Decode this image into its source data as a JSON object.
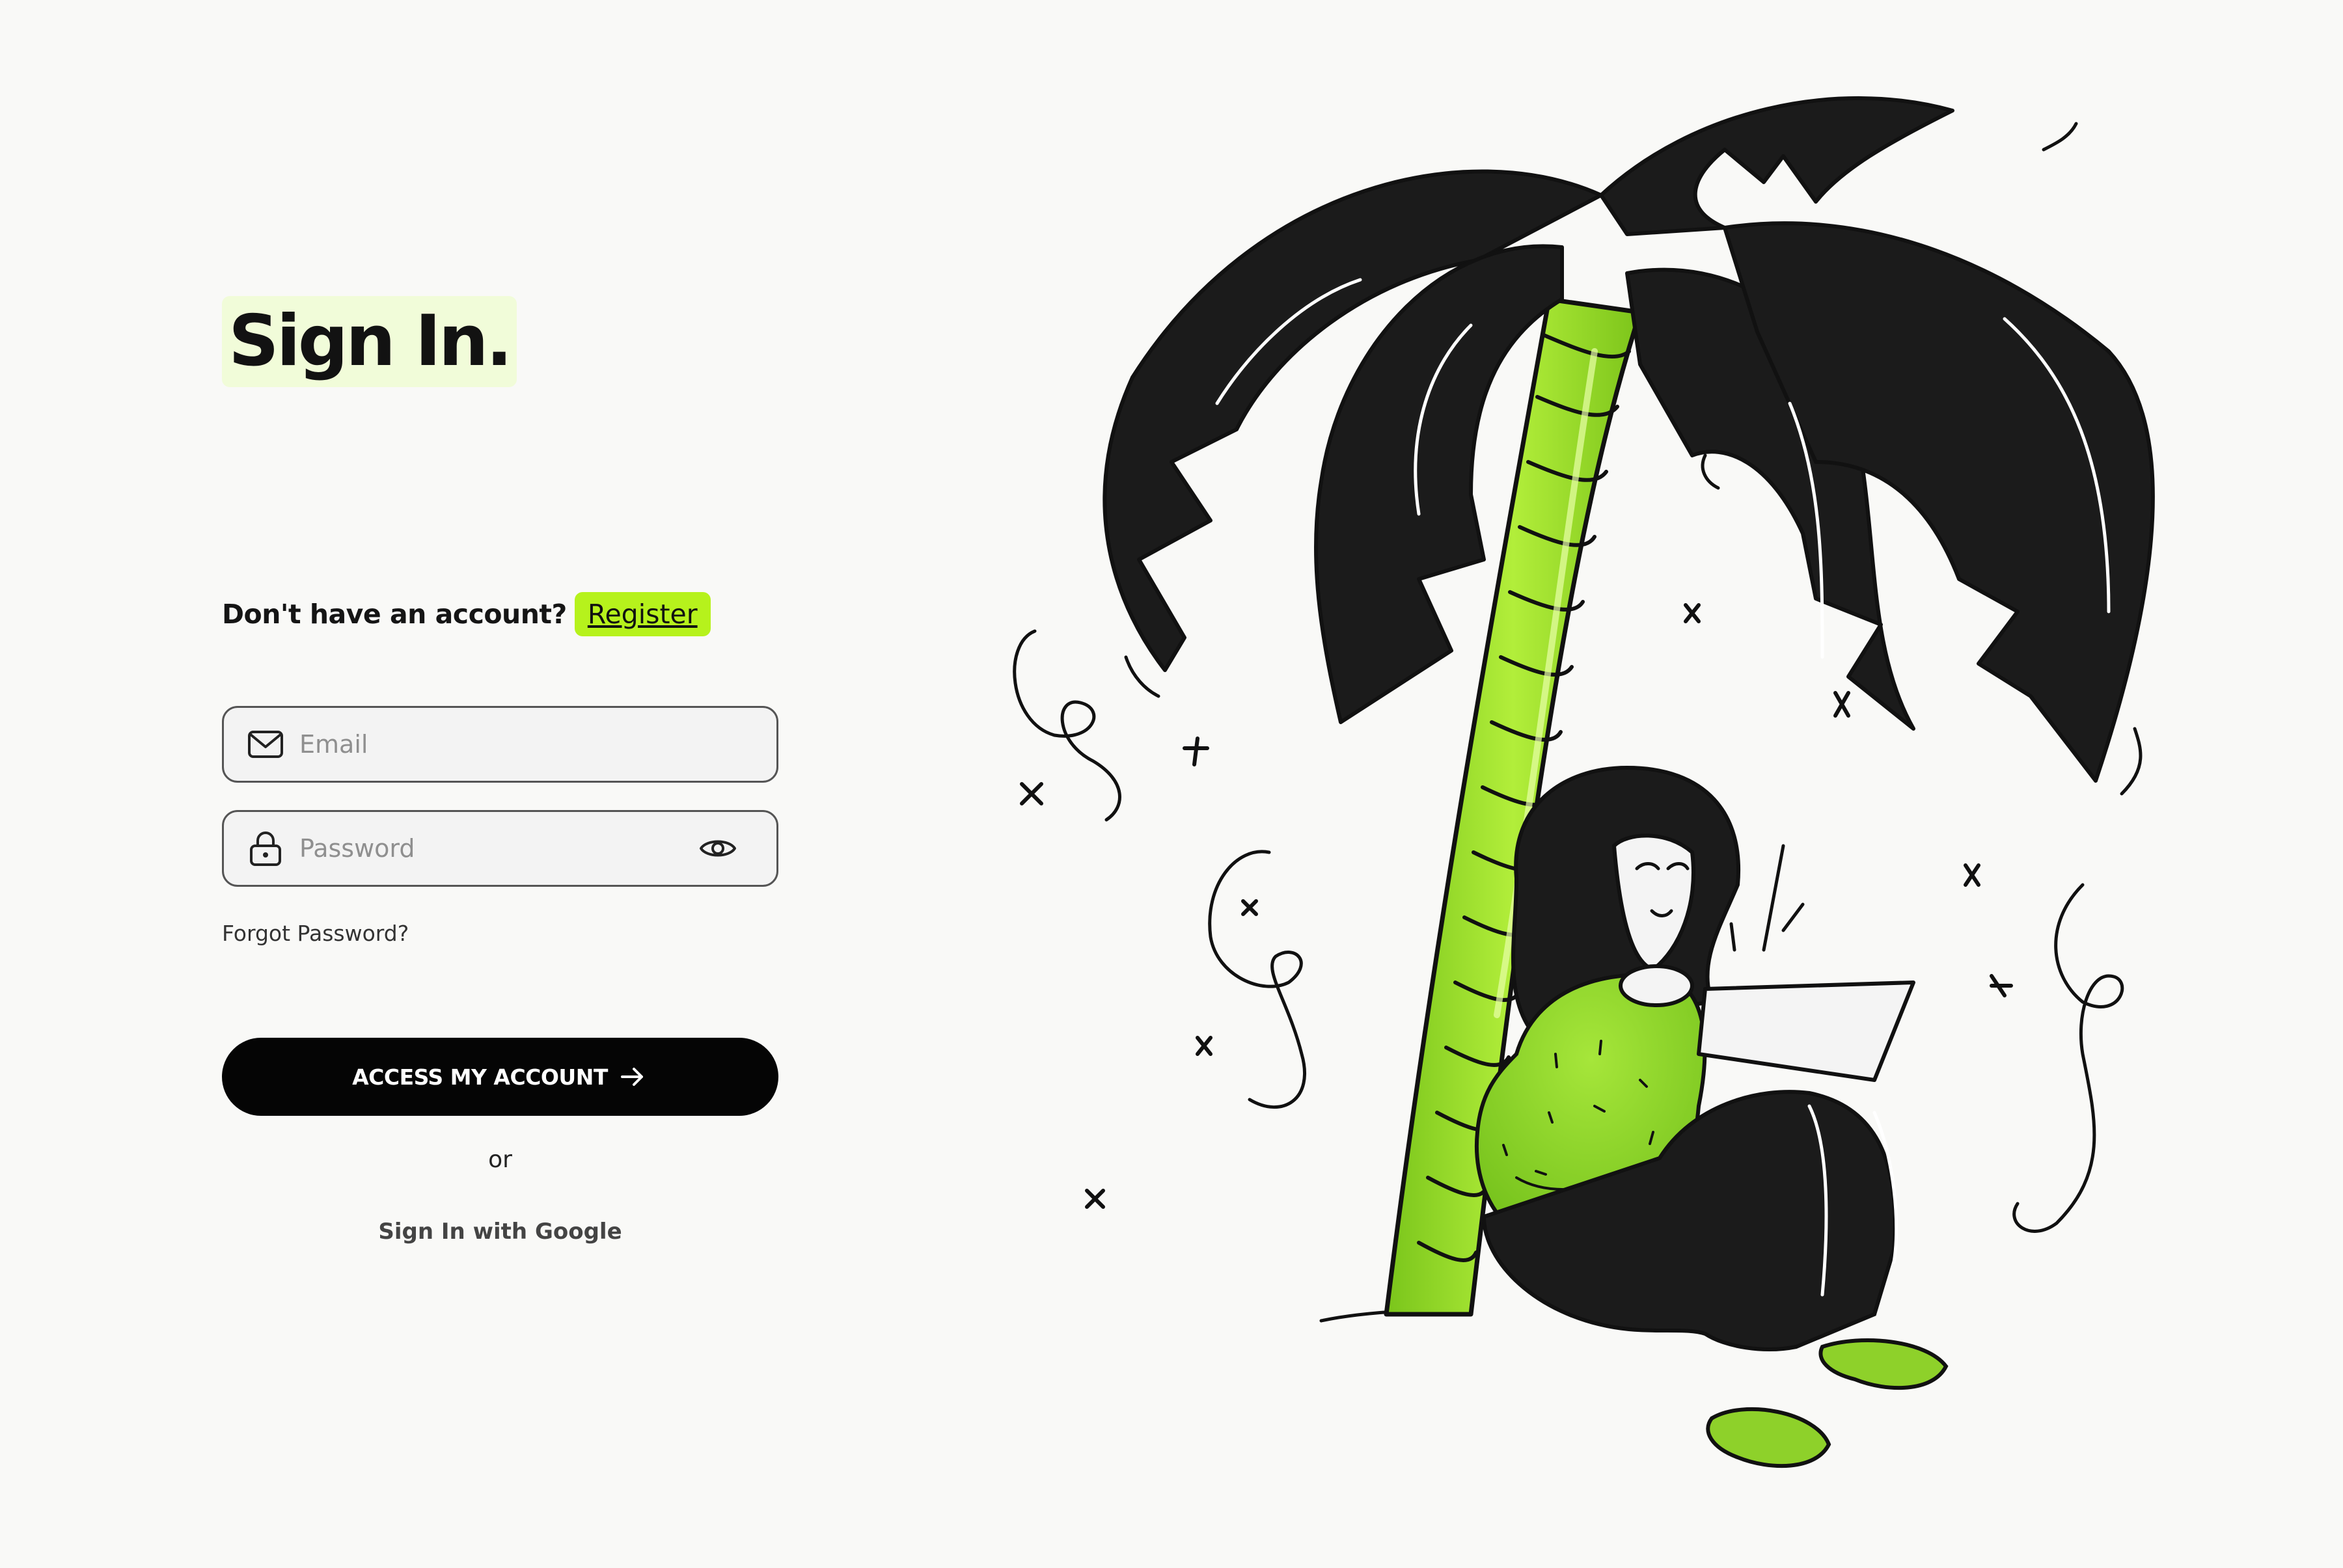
{
  "page": {
    "title": "Sign In."
  },
  "register": {
    "prompt": "Don't have an account?",
    "link": "Register"
  },
  "email": {
    "placeholder": "Email",
    "icon": "mail-icon"
  },
  "password": {
    "placeholder": "Password",
    "icon": "lock-icon",
    "toggle_icon": "eye-icon"
  },
  "forgot_password": "Forgot Password?",
  "primary_button": {
    "label": "ACCESS MY ACCOUNT",
    "icon": "arrow-right-icon"
  },
  "divider": "or",
  "google_signin": "Sign In with Google",
  "colors": {
    "accent": "#b6f21c",
    "title_highlight": "#f1fcd9",
    "background": "#f9f9f7",
    "primary": "#050505"
  }
}
